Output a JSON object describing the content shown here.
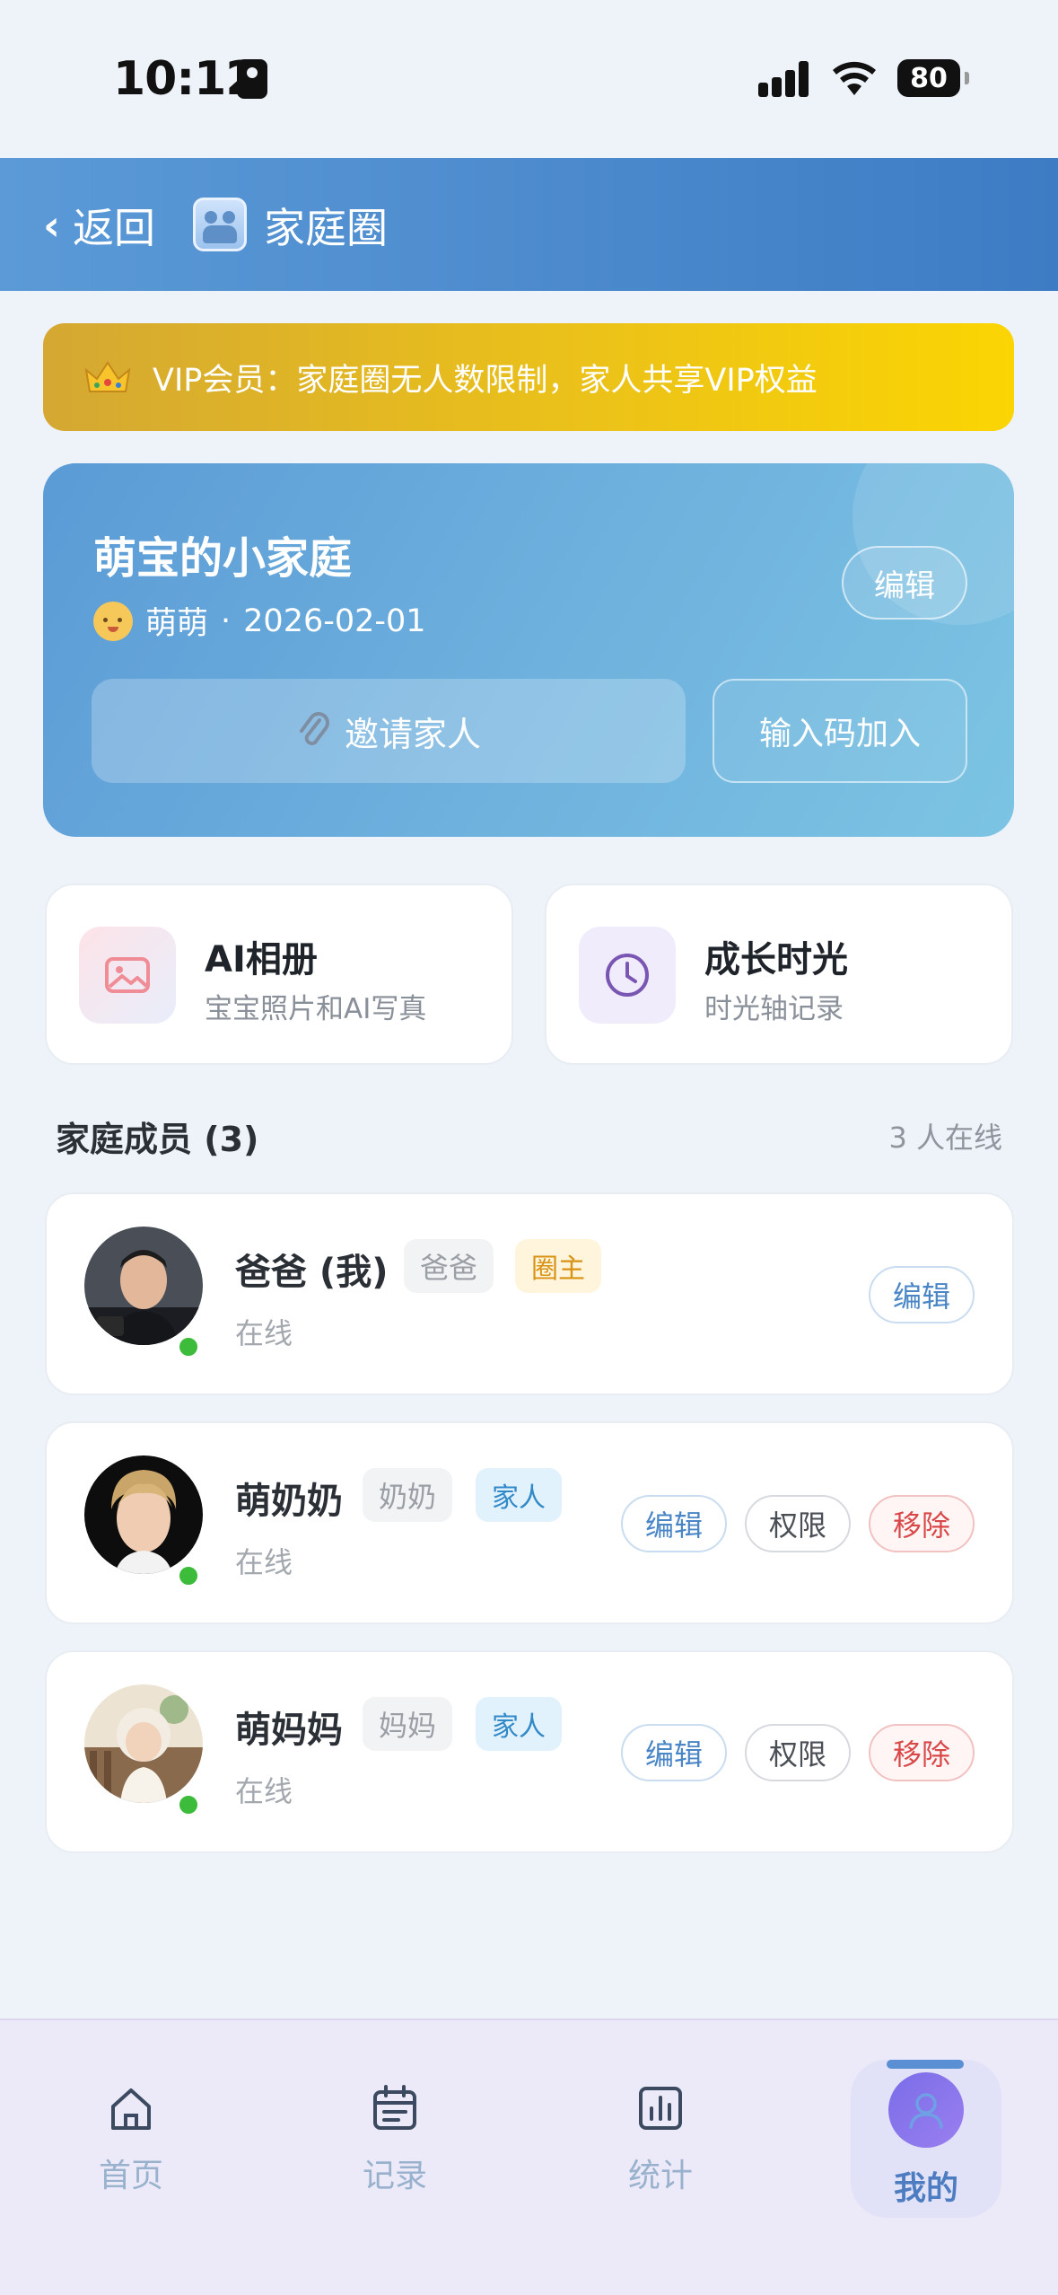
{
  "status_bar": {
    "time": "10:12",
    "battery": "80"
  },
  "header": {
    "back_label": "返回",
    "title": "家庭圈"
  },
  "vip_banner": {
    "text": "VIP会员：家庭圈无人数限制，家人共享VIP权益"
  },
  "family_card": {
    "name": "萌宝的小家庭",
    "baby_name": "萌萌",
    "separator": "·",
    "date": "2026-02-01",
    "edit_label": "编辑",
    "invite_label": "邀请家人",
    "join_label": "输入码加入"
  },
  "features": [
    {
      "title": "AI相册",
      "subtitle": "宝宝照片和AI写真",
      "icon": "image-icon"
    },
    {
      "title": "成长时光",
      "subtitle": "时光轴记录",
      "icon": "clock-icon"
    }
  ],
  "members_section": {
    "title": "家庭成员 (3)",
    "online_text": "3 人在线"
  },
  "members": [
    {
      "name": "爸爸 (我)",
      "role": "爸爸",
      "badge": "圈主",
      "status": "在线",
      "actions": [
        "编辑"
      ]
    },
    {
      "name": "萌奶奶",
      "role": "奶奶",
      "badge": "家人",
      "status": "在线",
      "actions": [
        "编辑",
        "权限",
        "移除"
      ]
    },
    {
      "name": "萌妈妈",
      "role": "妈妈",
      "badge": "家人",
      "status": "在线",
      "actions": [
        "编辑",
        "权限",
        "移除"
      ]
    }
  ],
  "bottom_nav": [
    {
      "label": "首页",
      "icon": "home-icon",
      "active": false
    },
    {
      "label": "记录",
      "icon": "calendar-icon",
      "active": false
    },
    {
      "label": "统计",
      "icon": "chart-icon",
      "active": false
    },
    {
      "label": "我的",
      "icon": "profile-icon",
      "active": true
    }
  ],
  "colors": {
    "header": "#4a88cc",
    "vip_start": "#d4a832",
    "vip_end": "#fbd503",
    "online_dot": "#3dbb3a",
    "remove": "#d94848",
    "nav_active": "#4d7dc0"
  }
}
